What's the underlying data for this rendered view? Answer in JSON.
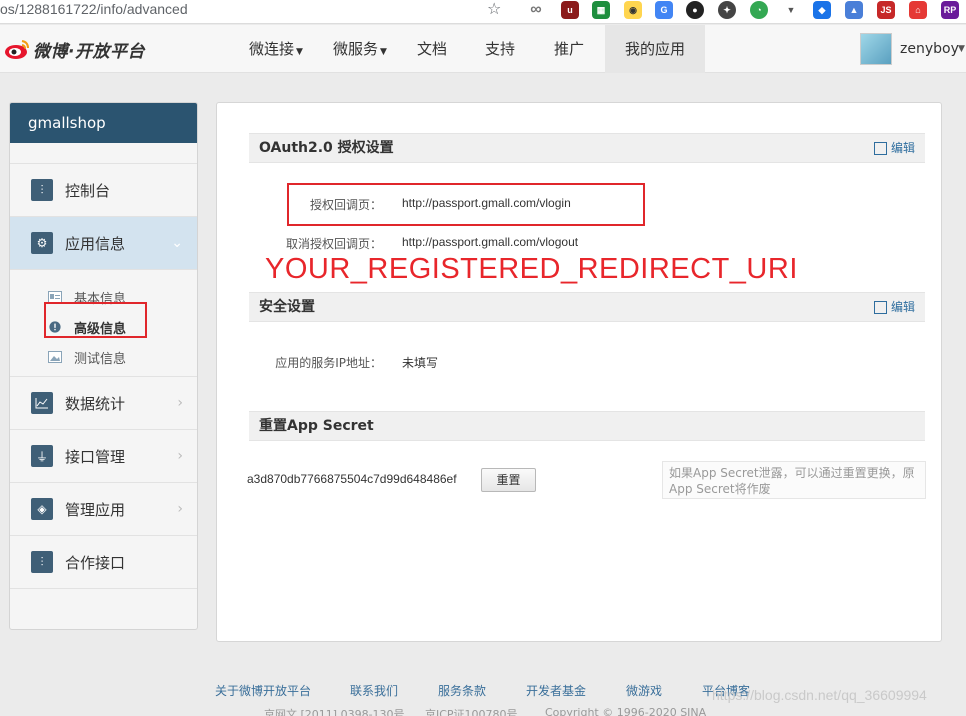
{
  "browser": {
    "url": "os/1288161722/info/advanced",
    "extensions": [
      "infinity-icon",
      "ublock-icon",
      "sheets-icon",
      "owl-icon",
      "translate-icon",
      "github-icon",
      "lightbulb-icon",
      "timer-icon",
      "vue-icon",
      "diamond-icon",
      "drive-icon",
      "js-icon",
      "home-icon",
      "rp-icon"
    ]
  },
  "header": {
    "logo_text": "微博·开放平台",
    "nav": [
      {
        "label": "微连接",
        "caret": "▼"
      },
      {
        "label": "微服务",
        "caret": "▼"
      },
      {
        "label": "文档"
      },
      {
        "label": "支持"
      },
      {
        "label": "推广"
      },
      {
        "label": "我的应用"
      }
    ],
    "username": "zenyboy"
  },
  "sidebar": {
    "app_name": "gmallshop",
    "items": [
      {
        "label": "控制台",
        "icon": "sliders-icon"
      },
      {
        "label": "应用信息",
        "icon": "gear-icon"
      },
      {
        "label": "数据统计",
        "icon": "chart-icon"
      },
      {
        "label": "接口管理",
        "icon": "plug-icon"
      },
      {
        "label": "管理应用",
        "icon": "layers-icon"
      },
      {
        "label": "合作接口",
        "icon": "sliders-icon"
      }
    ],
    "sub_items": [
      {
        "label": "基本信息"
      },
      {
        "label": "高级信息"
      },
      {
        "label": "测试信息"
      }
    ]
  },
  "main": {
    "oauth": {
      "title": "OAuth2.0 授权设置",
      "edit": "编辑",
      "callback_label": "授权回调页：",
      "callback_value": "http://passport.gmall.com/vlogin",
      "cancel_label": "取消授权回调页：",
      "cancel_value": "http://passport.gmall.com/vlogout"
    },
    "annotation": "YOUR_REGISTERED_REDIRECT_URI",
    "security": {
      "title": "安全设置",
      "edit": "编辑",
      "ip_label": "应用的服务IP地址：",
      "ip_value": "未填写"
    },
    "secret": {
      "title": "重置App Secret",
      "value": "a3d870db7766875504c7d99d648486ef",
      "reset": "重置",
      "hint": "如果App Secret泄露，可以通过重置更换，原App Secret将作废"
    }
  },
  "footer": {
    "links": [
      "关于微博开放平台",
      "联系我们",
      "服务条款",
      "开发者基金",
      "微游戏",
      "平台博客"
    ],
    "copy": [
      "京网文 [2011] 0398-130号",
      "京ICP证100780号",
      "Copyright © 1996-2020 SINA"
    ],
    "watermark": "https://blog.csdn.net/qq_36609994"
  }
}
